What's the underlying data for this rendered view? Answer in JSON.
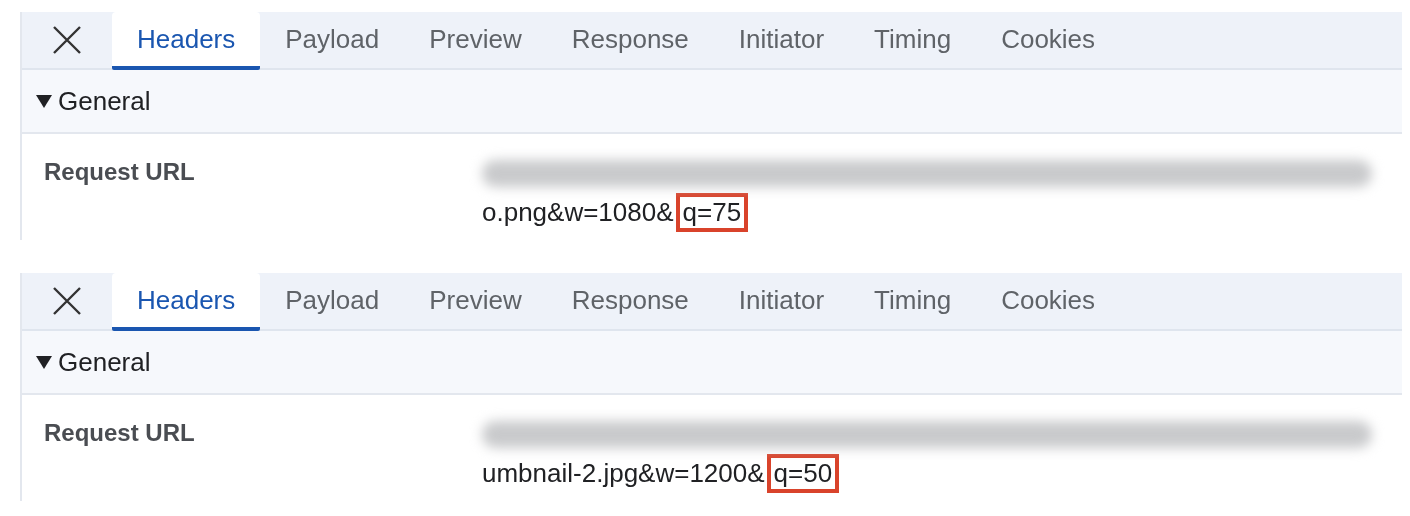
{
  "panels": [
    {
      "tabs": [
        {
          "label": "Headers",
          "selected": true
        },
        {
          "label": "Payload",
          "selected": false
        },
        {
          "label": "Preview",
          "selected": false
        },
        {
          "label": "Response",
          "selected": false
        },
        {
          "label": "Initiator",
          "selected": false
        },
        {
          "label": "Timing",
          "selected": false
        },
        {
          "label": "Cookies",
          "selected": false
        }
      ],
      "section": {
        "title": "General",
        "expanded": true
      },
      "rows": [
        {
          "label": "Request URL",
          "value": "o.png&w=1080&",
          "highlight": "q=75"
        }
      ]
    },
    {
      "tabs": [
        {
          "label": "Headers",
          "selected": true
        },
        {
          "label": "Payload",
          "selected": false
        },
        {
          "label": "Preview",
          "selected": false
        },
        {
          "label": "Response",
          "selected": false
        },
        {
          "label": "Initiator",
          "selected": false
        },
        {
          "label": "Timing",
          "selected": false
        },
        {
          "label": "Cookies",
          "selected": false
        }
      ],
      "section": {
        "title": "General",
        "expanded": true
      },
      "rows": [
        {
          "label": "Request URL",
          "value": "umbnail-2.jpg&w=1200&",
          "highlight": "q=50"
        }
      ]
    }
  ]
}
